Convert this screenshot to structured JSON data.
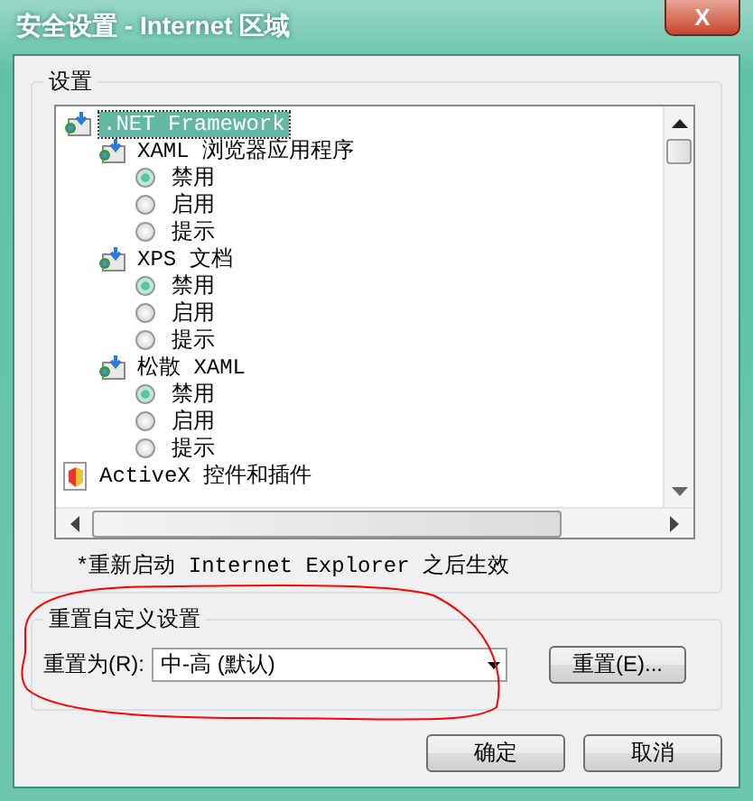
{
  "window": {
    "title": "安全设置 - Internet 区域",
    "close": "X"
  },
  "settings_group": {
    "title": "设置",
    "tree": [
      {
        "kind": "folder",
        "label": ".NET Framework",
        "selected": true,
        "children": [
          {
            "kind": "folder",
            "label": "XAML 浏览器应用程序",
            "selected": false,
            "children": [
              {
                "kind": "radio",
                "label": "禁用",
                "selected": true
              },
              {
                "kind": "radio",
                "label": "启用",
                "selected": false
              },
              {
                "kind": "radio",
                "label": "提示",
                "selected": false
              }
            ]
          },
          {
            "kind": "folder",
            "label": "XPS 文档",
            "selected": false,
            "children": [
              {
                "kind": "radio",
                "label": "禁用",
                "selected": true
              },
              {
                "kind": "radio",
                "label": "启用",
                "selected": false
              },
              {
                "kind": "radio",
                "label": "提示",
                "selected": false
              }
            ]
          },
          {
            "kind": "folder",
            "label": "松散 XAML",
            "selected": false,
            "children": [
              {
                "kind": "radio",
                "label": "禁用",
                "selected": true
              },
              {
                "kind": "radio",
                "label": "启用",
                "selected": false
              },
              {
                "kind": "radio",
                "label": "提示",
                "selected": false
              }
            ]
          }
        ]
      },
      {
        "kind": "activex",
        "label": "ActiveX 控件和插件",
        "selected": false
      }
    ],
    "note": "*重新启动 Internet Explorer 之后生效"
  },
  "reset_group": {
    "title": "重置自定义设置",
    "label": "重置为(R):",
    "value": "中-高 (默认)",
    "button": "重置(E)..."
  },
  "buttons": [
    "确定",
    "取消"
  ],
  "annotation": {
    "kind": "circle"
  }
}
